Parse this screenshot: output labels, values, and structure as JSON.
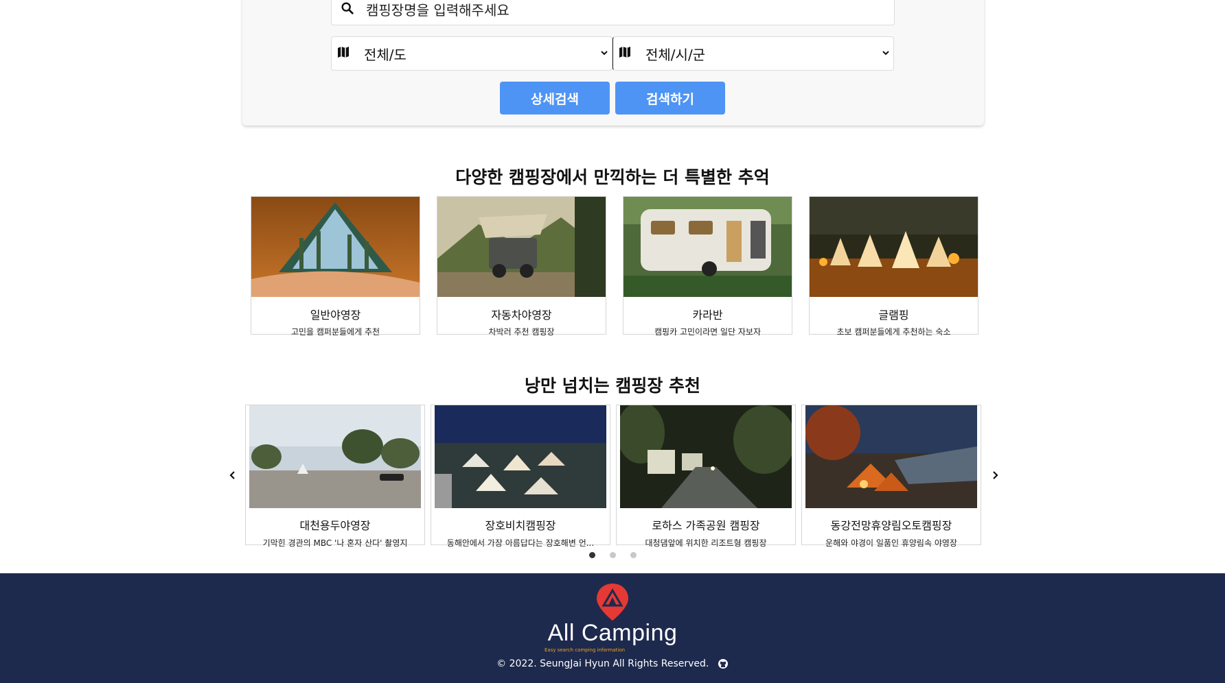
{
  "search": {
    "placeholder": "캠핑장명을 입력해주세요",
    "province_selected": "전체/도",
    "city_selected": "전체/시/군",
    "detail_button": "상세검색",
    "search_button": "검색하기"
  },
  "types_section": {
    "title": "다양한 캠핑장에서 만끽하는 더 특별한 추억",
    "cards": [
      {
        "name": "일반야영장",
        "desc": "고민을 캠퍼분들에게 추천"
      },
      {
        "name": "자동차야영장",
        "desc": "차박러 추천 캠핑장"
      },
      {
        "name": "카라반",
        "desc": "캠핑카 고민이라면 일단 자보자"
      },
      {
        "name": "글램핑",
        "desc": "초보 캠퍼분들에게 추천하는 숙소"
      }
    ]
  },
  "recommend_section": {
    "title": "낭만 넘치는 캠핑장 추천",
    "cards": [
      {
        "name": "대천용두야영장",
        "desc": "기막힌 경관의 MBC '나 혼자 산다' 촬영지"
      },
      {
        "name": "장호비치캠핑장",
        "desc": "동해안에서 가장 아름답다는 장호해변 언..."
      },
      {
        "name": "로하스 가족공원 캠핑장",
        "desc": "대청댐앞에 위치한 리조트형 캠핑장"
      },
      {
        "name": "동강전망휴양림오토캠핑장",
        "desc": "운해와 야경이 일품인 휴양림속 야영장"
      }
    ],
    "active_page": 1,
    "page_count": 3
  },
  "footer": {
    "brand": "All Camping",
    "tagline": "Easy search camping information",
    "copyright": "© 2022. SeungJai Hyun All Rights Reserved."
  },
  "colors": {
    "button": "#4e94f5",
    "footer_bg": "#1e2a4d",
    "logo_red": "#e53935"
  }
}
